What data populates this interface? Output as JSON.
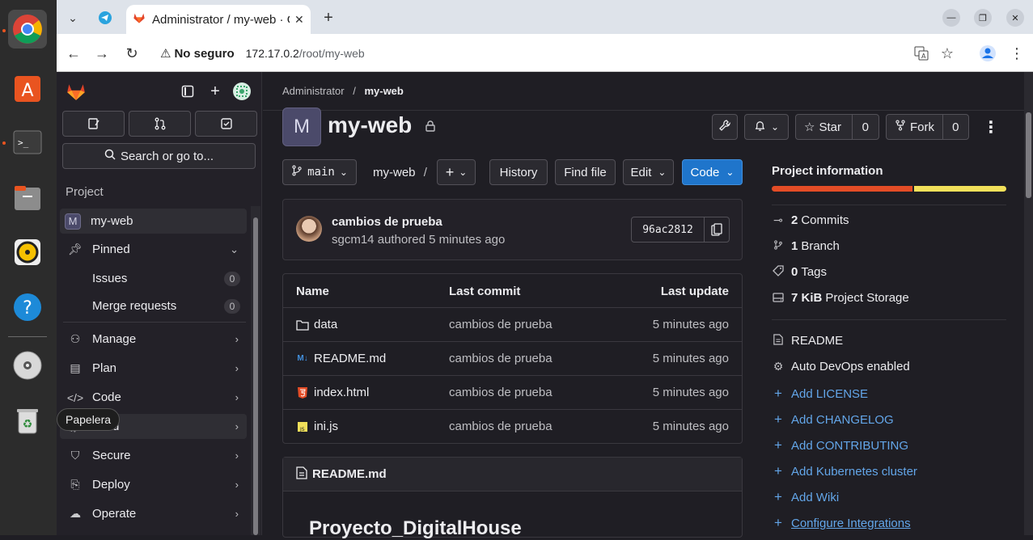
{
  "dock": {
    "items": [
      "chrome-icon",
      "app-store-icon",
      "terminal-icon",
      "files-icon",
      "rhythmbox-icon",
      "help-icon",
      "cd-icon",
      "trash-icon"
    ],
    "tooltip": "Papelera"
  },
  "browser": {
    "tab_title": "Administrator / my-web · GitLab",
    "security_label": "No seguro",
    "url_host": "172.17.0.2",
    "url_path": "/root/my-web"
  },
  "sidebar": {
    "search_placeholder": "Search or go to...",
    "section_label": "Project",
    "project_avatar_letter": "M",
    "project_name": "my-web",
    "items": [
      {
        "label": "Pinned"
      },
      {
        "label": "Issues",
        "count": "0"
      },
      {
        "label": "Merge requests",
        "count": "0"
      },
      {
        "label": "Manage"
      },
      {
        "label": "Plan"
      },
      {
        "label": "Code"
      },
      {
        "label": "Build"
      },
      {
        "label": "Secure"
      },
      {
        "label": "Deploy"
      },
      {
        "label": "Operate"
      }
    ]
  },
  "breadcrumb": {
    "parent": "Administrator",
    "separator": "/",
    "current": "my-web"
  },
  "project": {
    "avatar_letter": "M",
    "title": "my-web",
    "star_label": "Star",
    "star_count": "0",
    "fork_label": "Fork",
    "fork_count": "0"
  },
  "toolbar": {
    "branch": "main",
    "path": "my-web",
    "path_sep": "/",
    "history": "History",
    "find_file": "Find file",
    "edit": "Edit",
    "code": "Code"
  },
  "commit": {
    "title": "cambios de prueba",
    "meta": "sgcm14 authored 5 minutes ago",
    "sha": "96ac2812"
  },
  "files": {
    "headers": {
      "name": "Name",
      "last_commit": "Last commit",
      "last_update": "Last update"
    },
    "rows": [
      {
        "name": "data",
        "icon": "folder-icon",
        "commit": "cambios de prueba",
        "update": "5 minutes ago"
      },
      {
        "name": "README.md",
        "icon": "markdown-icon",
        "commit": "cambios de prueba",
        "update": "5 minutes ago"
      },
      {
        "name": "index.html",
        "icon": "html5-icon",
        "commit": "cambios de prueba",
        "update": "5 minutes ago"
      },
      {
        "name": "ini.js",
        "icon": "javascript-icon",
        "commit": "cambios de prueba",
        "update": "5 minutes ago"
      }
    ]
  },
  "readme": {
    "filename": "README.md",
    "heading": "Proyecto_DigitalHouse"
  },
  "info": {
    "title": "Project information",
    "language_bar": [
      {
        "share": 0.6,
        "color": "#e34c26"
      },
      {
        "share": 0.4,
        "color": "#f1e05a"
      }
    ],
    "commits_count": "2",
    "commits_label": "Commits",
    "branch_count": "1",
    "branch_label": "Branch",
    "tags_count": "0",
    "tags_label": "Tags",
    "storage_size": "7 KiB",
    "storage_label": "Project Storage",
    "readme": "README",
    "autodevops": "Auto DevOps enabled",
    "links": [
      "Add LICENSE",
      "Add CHANGELOG",
      "Add CONTRIBUTING",
      "Add Kubernetes cluster",
      "Add Wiki",
      "Configure Integrations"
    ]
  }
}
